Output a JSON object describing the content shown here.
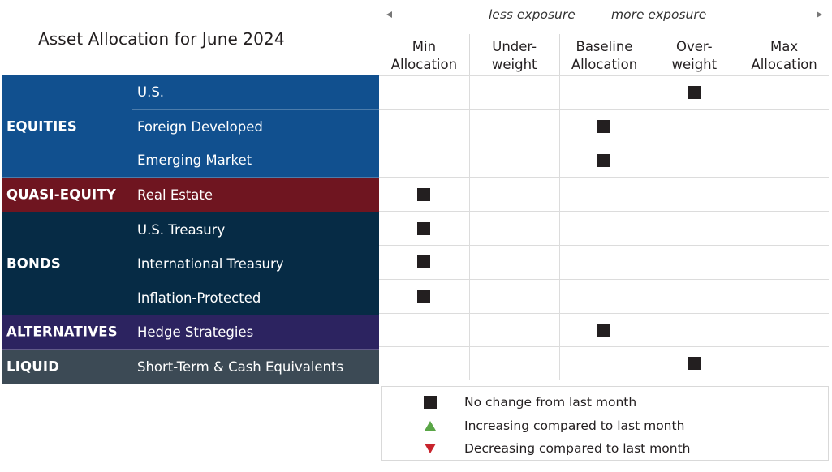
{
  "title": "Asset Allocation for June 2024",
  "exposure": {
    "less_label": "less exposure",
    "more_label": "more exposure"
  },
  "colors": {
    "equities": "#11508f",
    "quasi_equity": "#6f1520",
    "bonds": "#062b45",
    "alternatives": "#2c2360",
    "liquid": "#3c4a55",
    "no_change": "#231f20",
    "increasing": "#5aa647",
    "decreasing": "#c8232c"
  },
  "chart_data": {
    "type": "table",
    "title": "Asset Allocation for June 2024",
    "columns": [
      {
        "line1": "Min",
        "line2": "Allocation"
      },
      {
        "line1": "Under-",
        "line2": "weight"
      },
      {
        "line1": "Baseline",
        "line2": "Allocation"
      },
      {
        "line1": "Over-",
        "line2": "weight"
      },
      {
        "line1": "Max",
        "line2": "Allocation"
      }
    ],
    "groups": [
      {
        "name": "EQUITIES",
        "color_key": "equities",
        "rows": [
          {
            "asset": "U.S.",
            "allocation": "Over-weight",
            "column_index": 3,
            "change": "no_change"
          },
          {
            "asset": "Foreign Developed",
            "allocation": "Baseline Allocation",
            "column_index": 2,
            "change": "no_change"
          },
          {
            "asset": "Emerging Market",
            "allocation": "Baseline Allocation",
            "column_index": 2,
            "change": "no_change"
          }
        ]
      },
      {
        "name": "QUASI-EQUITY",
        "color_key": "quasi_equity",
        "rows": [
          {
            "asset": "Real Estate",
            "allocation": "Min Allocation",
            "column_index": 0,
            "change": "no_change"
          }
        ]
      },
      {
        "name": "BONDS",
        "color_key": "bonds",
        "rows": [
          {
            "asset": "U.S. Treasury",
            "allocation": "Min Allocation",
            "column_index": 0,
            "change": "no_change"
          },
          {
            "asset": "International Treasury",
            "allocation": "Min Allocation",
            "column_index": 0,
            "change": "no_change"
          },
          {
            "asset": "Inflation-Protected",
            "allocation": "Min Allocation",
            "column_index": 0,
            "change": "no_change"
          }
        ]
      },
      {
        "name": "ALTERNATIVES",
        "color_key": "alternatives",
        "rows": [
          {
            "asset": "Hedge Strategies",
            "allocation": "Baseline Allocation",
            "column_index": 2,
            "change": "no_change"
          }
        ]
      },
      {
        "name": "LIQUID",
        "color_key": "liquid",
        "rows": [
          {
            "asset": "Short-Term & Cash Equivalents",
            "allocation": "Over-weight",
            "column_index": 3,
            "change": "no_change"
          }
        ]
      }
    ],
    "legend": [
      {
        "icon": "square-icon",
        "key": "no_change",
        "label": "No change from last month"
      },
      {
        "icon": "triangle-up-icon",
        "key": "increasing",
        "label": "Increasing compared to last month"
      },
      {
        "icon": "triangle-down-icon",
        "key": "decreasing",
        "label": "Decreasing compared to last month"
      }
    ]
  }
}
